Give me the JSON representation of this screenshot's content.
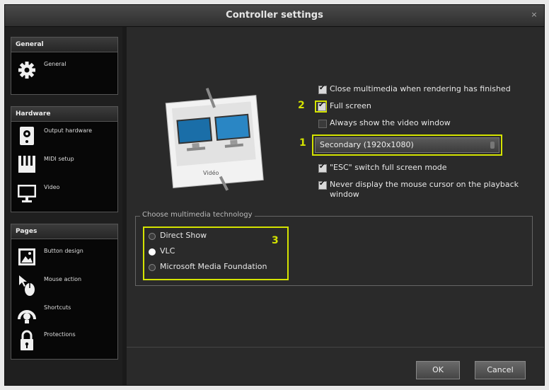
{
  "window": {
    "title": "Controller settings",
    "close_glyph": "×"
  },
  "sidebar": {
    "sections": [
      {
        "header": "General",
        "items": [
          {
            "label": "General",
            "icon": "gear-icon"
          }
        ]
      },
      {
        "header": "Hardware",
        "items": [
          {
            "label": "Output hardware",
            "icon": "output-hardware-icon"
          },
          {
            "label": "MIDI setup",
            "icon": "midi-keyboard-icon"
          },
          {
            "label": "Video",
            "icon": "monitor-icon"
          }
        ]
      },
      {
        "header": "Pages",
        "items": [
          {
            "label": "Button design",
            "icon": "image-icon"
          },
          {
            "label": "Mouse action",
            "icon": "mouse-icon"
          },
          {
            "label": "Shortcuts",
            "icon": "shortcut-icon"
          },
          {
            "label": "Protections",
            "icon": "lock-icon"
          }
        ]
      }
    ]
  },
  "main": {
    "illustration_caption": "Vidéo",
    "options": {
      "close_multimedia": "Close multimedia when rendering has finished",
      "full_screen": "Full screen",
      "always_show": "Always show the video window",
      "esc_switch": "\"ESC\" switch full screen mode",
      "never_display": "Never display the mouse cursor on the playback window"
    },
    "display_select": {
      "value": "Secondary (1920x1080)"
    },
    "tech_group": {
      "legend": "Choose multimedia technology",
      "options": [
        "Direct Show",
        "VLC",
        "Microsoft Media Foundation"
      ],
      "selected": "VLC"
    },
    "annotations": {
      "one": "1",
      "two": "2",
      "three": "3"
    }
  },
  "footer": {
    "ok": "OK",
    "cancel": "Cancel"
  },
  "colors": {
    "highlight": "#d4e300",
    "window_bg": "#2b2b2b"
  }
}
